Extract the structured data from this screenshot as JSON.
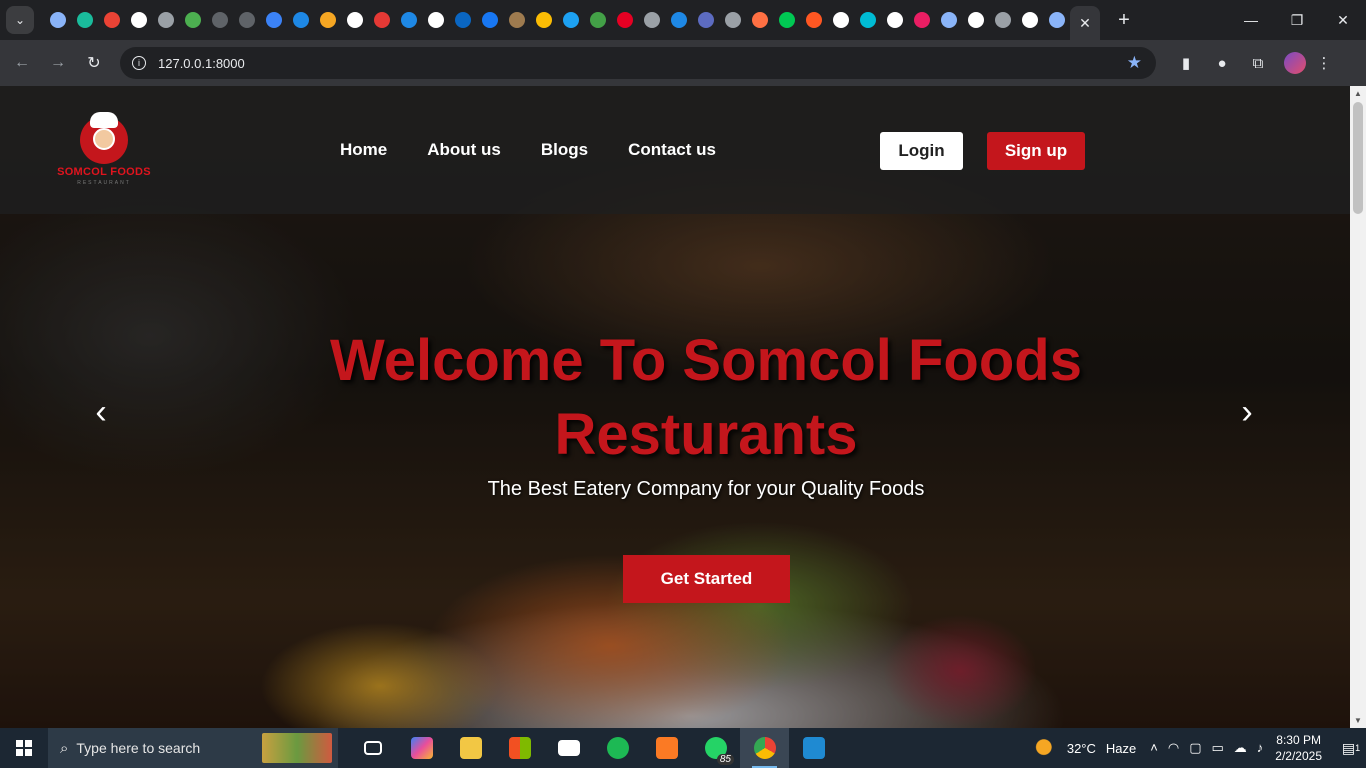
{
  "browser": {
    "tab_favicon_colors": [
      "#8ab4f8",
      "#1abc9c",
      "#ea4335",
      "#ffffff",
      "#9aa0a6",
      "#4caf50",
      "#5f6368",
      "#5f6368",
      "#3b82f6",
      "#1e88e5",
      "#f5a623",
      "#ffffff",
      "#e53935",
      "#1e88e5",
      "#ffffff",
      "#0a66c2",
      "#1877f2",
      "#9e7b4f",
      "#fbbc04",
      "#1da1f2",
      "#43a047",
      "#e60023",
      "#9aa0a6",
      "#1e88e5",
      "#5c6bc0",
      "#9aa0a6",
      "#ff7043",
      "#00c853",
      "#ff5722",
      "#ffffff",
      "#00bcd4",
      "#ffffff",
      "#e91e63",
      "#8ab4f8",
      "#ffffff",
      "#9aa0a6",
      "#ffffff",
      "#8ab4f8"
    ],
    "url": "127.0.0.1:8000",
    "close_tab_symbol": "✕",
    "new_tab_symbol": "+"
  },
  "site": {
    "logo_name": "SOMCOL FOODS",
    "logo_sub": "RESTAURANT",
    "nav": [
      "Home",
      "About us",
      "Blogs",
      "Contact us"
    ],
    "login_label": "Login",
    "signup_label": "Sign up",
    "accent_color": "#c4161c"
  },
  "hero": {
    "title": "Welcome To Somcol Foods Resturants",
    "subtitle": "The Best Eatery Company for your Quality Foods",
    "cta_label": "Get Started",
    "prev_symbol": "‹",
    "next_symbol": "›"
  },
  "taskbar": {
    "search_placeholder": "Type here to search",
    "whatsapp_badge": "85",
    "weather_temp": "32°C",
    "weather_desc": "Haze",
    "time": "8:30 PM",
    "date": "2/2/2025",
    "notification_count": "1"
  }
}
